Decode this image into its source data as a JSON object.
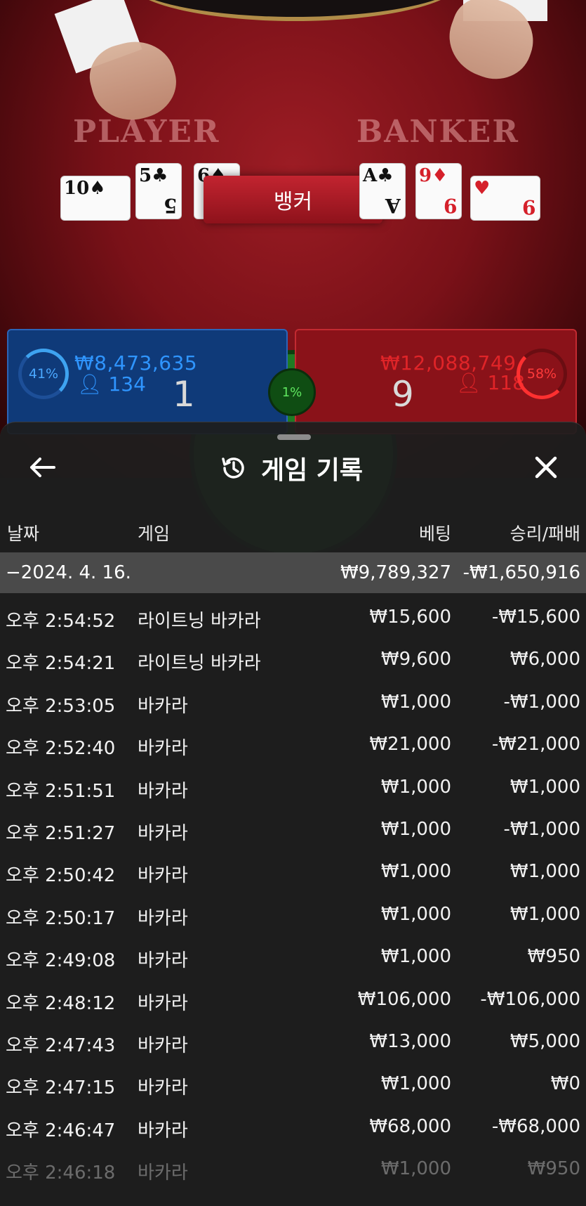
{
  "table": {
    "player_label": "PLAYER",
    "banker_label": "BANKER",
    "result_banner": "뱅커",
    "player_cards": [
      {
        "rank": "10",
        "suit": "♠",
        "color": "black"
      },
      {
        "rank": "5",
        "suit": "♣",
        "color": "black"
      },
      {
        "rank": "6",
        "suit": "♠",
        "color": "black"
      }
    ],
    "banker_cards": [
      {
        "rank": "A",
        "suit": "♣",
        "color": "black"
      },
      {
        "rank": "9",
        "suit": "♦",
        "color": "red"
      },
      {
        "rank": "9",
        "suit": "♥",
        "color": "red"
      }
    ]
  },
  "player_panel": {
    "percent": "41%",
    "amount": "₩8,473,635",
    "players": "134",
    "score": "1"
  },
  "banker_panel": {
    "percent": "58%",
    "amount": "₩12,088,749",
    "players": "118",
    "score": "9"
  },
  "tie_panel": {
    "percent": "1%"
  },
  "history": {
    "title": "게임 기록",
    "icons": {
      "back": "arrow-left-icon",
      "history": "history-icon",
      "close": "close-icon"
    },
    "columns": {
      "date": "날짜",
      "game": "게임",
      "bet": "베팅",
      "win_loss": "승리/패배"
    },
    "date_group": {
      "date": "−2024. 4. 16.",
      "bet_total": "₩9,789,327",
      "win_total": "-₩1,650,916"
    },
    "rows": [
      {
        "time": "오후 2:54:52",
        "game": "라이트닝 바카라",
        "bet": "₩15,600",
        "result": "-₩15,600"
      },
      {
        "time": "오후 2:54:21",
        "game": "라이트닝 바카라",
        "bet": "₩9,600",
        "result": "₩6,000"
      },
      {
        "time": "오후 2:53:05",
        "game": "바카라",
        "bet": "₩1,000",
        "result": "-₩1,000"
      },
      {
        "time": "오후 2:52:40",
        "game": "바카라",
        "bet": "₩21,000",
        "result": "-₩21,000"
      },
      {
        "time": "오후 2:51:51",
        "game": "바카라",
        "bet": "₩1,000",
        "result": "₩1,000"
      },
      {
        "time": "오후 2:51:27",
        "game": "바카라",
        "bet": "₩1,000",
        "result": "-₩1,000"
      },
      {
        "time": "오후 2:50:42",
        "game": "바카라",
        "bet": "₩1,000",
        "result": "₩1,000"
      },
      {
        "time": "오후 2:50:17",
        "game": "바카라",
        "bet": "₩1,000",
        "result": "₩1,000"
      },
      {
        "time": "오후 2:49:08",
        "game": "바카라",
        "bet": "₩1,000",
        "result": "₩950"
      },
      {
        "time": "오후 2:48:12",
        "game": "바카라",
        "bet": "₩106,000",
        "result": "-₩106,000"
      },
      {
        "time": "오후 2:47:43",
        "game": "바카라",
        "bet": "₩13,000",
        "result": "₩5,000"
      },
      {
        "time": "오후 2:47:15",
        "game": "바카라",
        "bet": "₩1,000",
        "result": "₩0"
      },
      {
        "time": "오후 2:46:47",
        "game": "바카라",
        "bet": "₩68,000",
        "result": "-₩68,000"
      },
      {
        "time": "오후 2:46:18",
        "game": "바카라",
        "bet": "₩1,000",
        "result": "₩950"
      }
    ]
  },
  "colors": {
    "player_blue": "#2f95ff",
    "banker_red": "#e02428",
    "tie_green": "#1f7a23",
    "sheet_bg": "#1e1e1e",
    "date_row_bg": "#4a4a4a"
  }
}
